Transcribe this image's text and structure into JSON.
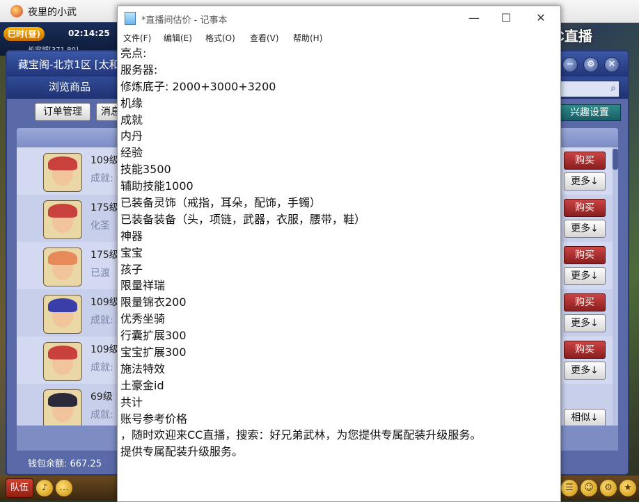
{
  "game_window": {
    "title": "夜里的小武"
  },
  "status": {
    "time_badge": "巳时(昼)",
    "clock": "02:14:25",
    "location": "长安城[371,80]"
  },
  "cc_logo": "CC直播",
  "dialog": {
    "title": "藏宝阁-北京1区 [太和",
    "tab_browse": "浏览商品",
    "order_btn": "订单管理",
    "msg_btn": "消息",
    "interest_btn": "兴趣设置",
    "wallet": "钱包余额: 667.25",
    "rows": [
      {
        "level": "109级",
        "sub": "成就:",
        "action": "购买",
        "more": "更多↓",
        "hair": "#c8413c"
      },
      {
        "level": "175级",
        "sub": "化圣",
        "action": "购买",
        "more": "更多↓",
        "hair": "#c8413c"
      },
      {
        "level": "175级",
        "sub": "已渡",
        "action": "购买",
        "more": "更多↓",
        "hair": "#e68a5a"
      },
      {
        "level": "109级",
        "sub": "成就:",
        "action": "购买",
        "more": "更多↓",
        "hair": "#3a3ea8"
      },
      {
        "level": "109级",
        "sub": "成就:",
        "action": "购买",
        "more": "更多↓",
        "hair": "#c8413c"
      },
      {
        "level": "69级",
        "sub": "成就:",
        "action": "",
        "more": "相似↓",
        "hair": "#2a2a3a"
      }
    ]
  },
  "bottom_bar": {
    "team": "队伍"
  },
  "notepad": {
    "title": "*直播间估价 - 记事本",
    "menu": {
      "file": "文件(F)",
      "edit": "编辑(E)",
      "format": "格式(O)",
      "view": "查看(V)",
      "help": "帮助(H)"
    },
    "controls": {
      "minimize": "—",
      "maximize": "☐",
      "close": "✕"
    },
    "lines": [
      "亮点:",
      "服务器:",
      "修炼底子: 2000+3000+3200",
      "机缘",
      "成就",
      "内丹",
      "经验",
      "技能3500",
      "辅助技能1000",
      "已装备灵饰（戒指，耳朵，配饰，手镯）",
      "已装备装备（头，项链，武器，衣服，腰带，鞋）",
      "神器",
      "宝宝",
      "孩子",
      "限量祥瑞",
      "限量锦衣200",
      "优秀坐骑",
      "行囊扩展300",
      "宝宝扩展300",
      "施法特效",
      "土豪金id",
      "共计",
      "账号参考价格",
      "，随时欢迎来CC直播，搜索：好兄弟武林，为您提供专属配装升级服务。",
      "提供专属配装升级服务。"
    ]
  }
}
